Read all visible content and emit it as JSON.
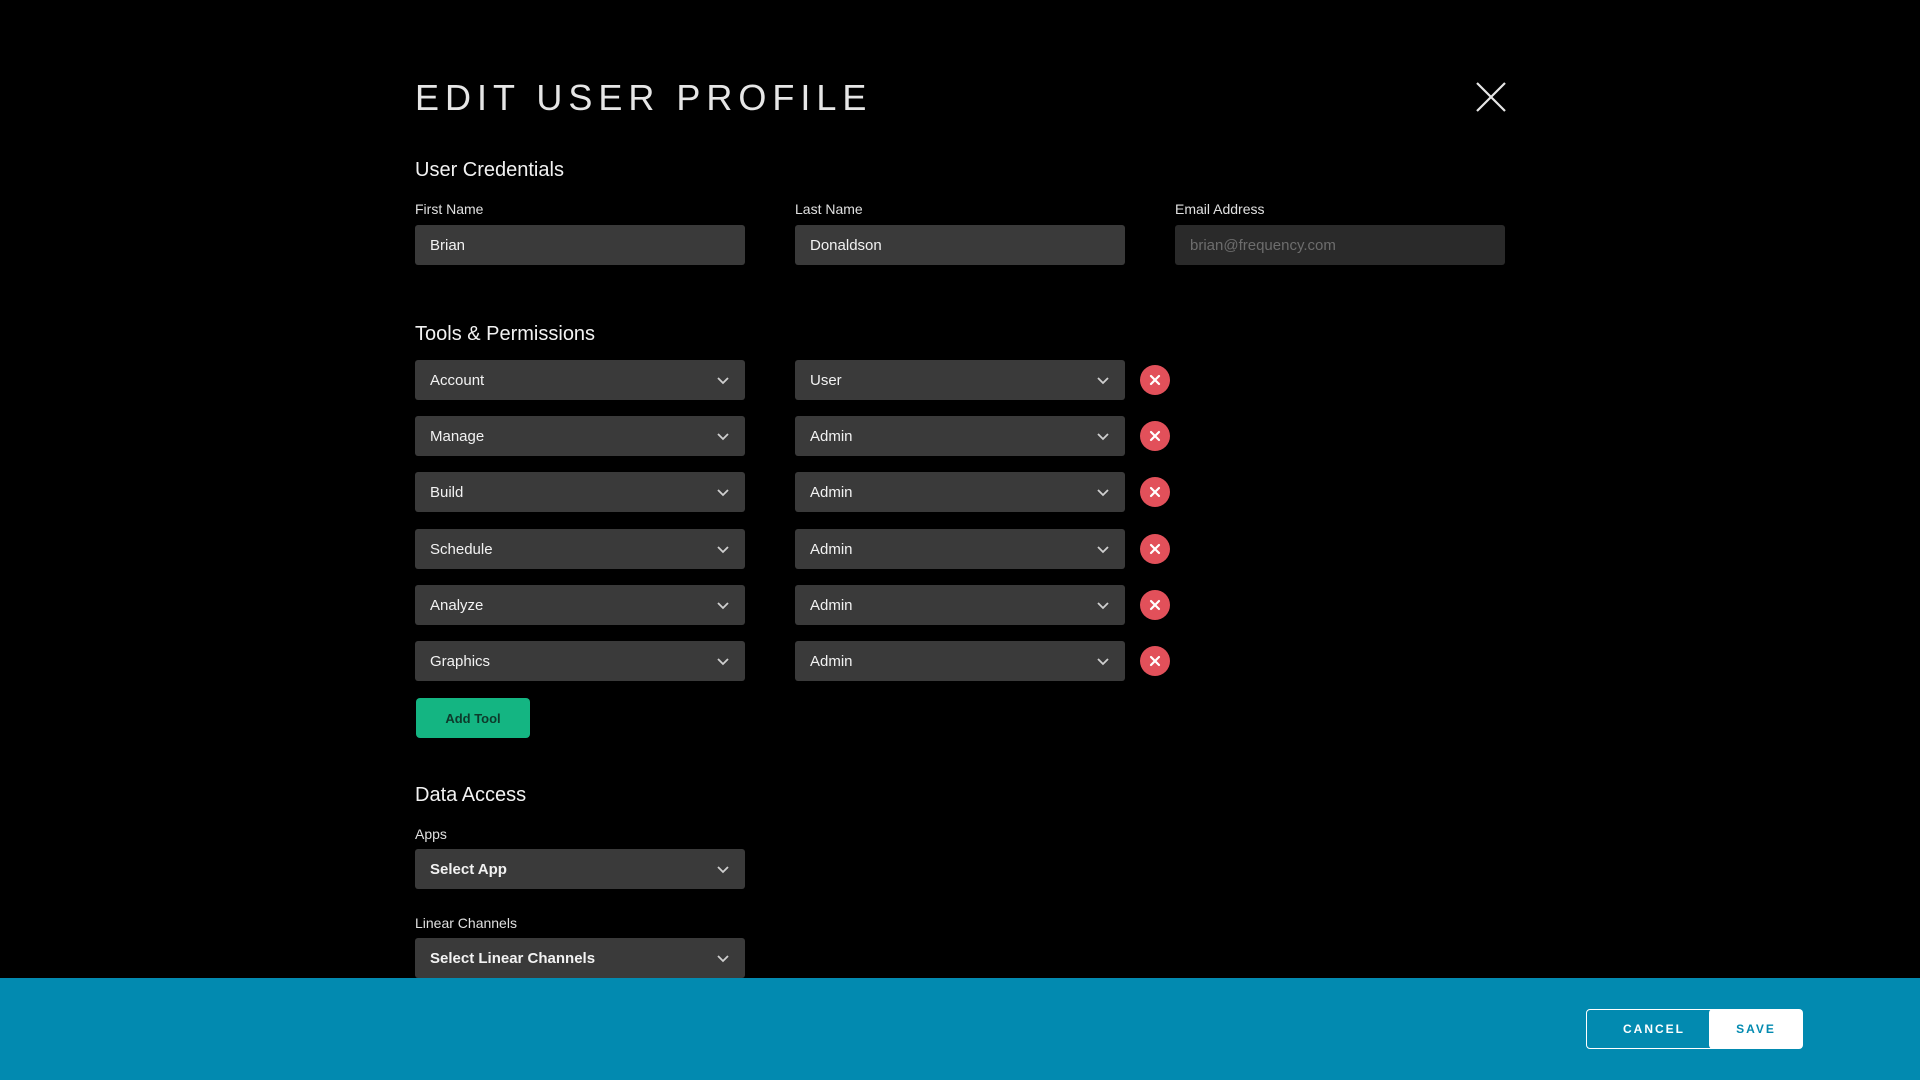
{
  "header": {
    "title": "EDIT USER PROFILE",
    "close_icon": "close-icon"
  },
  "credentials": {
    "heading": "User Credentials",
    "first_name_label": "First Name",
    "first_name_value": "Brian",
    "last_name_label": "Last Name",
    "last_name_value": "Donaldson",
    "email_label": "Email Address",
    "email_placeholder": "brian@frequency.com"
  },
  "tools": {
    "heading": "Tools & Permissions",
    "rows": [
      {
        "tool": "Account",
        "role": "User"
      },
      {
        "tool": "Manage",
        "role": "Admin"
      },
      {
        "tool": "Build",
        "role": "Admin"
      },
      {
        "tool": "Schedule",
        "role": "Admin"
      },
      {
        "tool": "Analyze",
        "role": "Admin"
      },
      {
        "tool": "Graphics",
        "role": "Admin"
      }
    ],
    "add_label": "Add Tool"
  },
  "data_access": {
    "heading": "Data Access",
    "apps_label": "Apps",
    "apps_value": "Select App",
    "channels_label": "Linear Channels",
    "channels_value": "Select Linear Channels"
  },
  "footer": {
    "cancel_label": "CANCEL",
    "save_label": "SAVE"
  },
  "colors": {
    "background": "#000000",
    "field": "#3a3a3a",
    "remove": "#e2505a",
    "add_tool": "#14b582",
    "footer": "#028ab0"
  }
}
